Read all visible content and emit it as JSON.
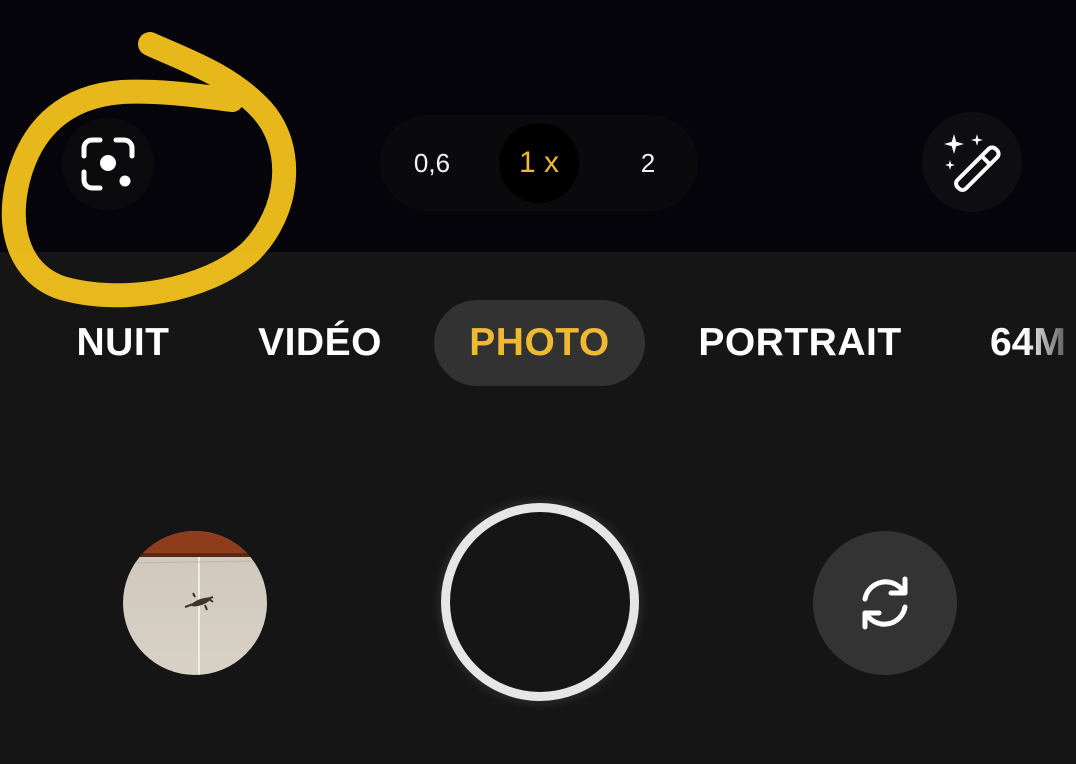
{
  "top_bar": {
    "lens_icon": "google-lens-icon",
    "zoom_options": [
      {
        "label": "0,6",
        "active": false
      },
      {
        "label": "1 x",
        "active": true
      },
      {
        "label": "2",
        "active": false
      }
    ],
    "effects_icon": "magic-wand-icon"
  },
  "modes": [
    {
      "label": "NUIT",
      "active": false
    },
    {
      "label": "VIDÉO",
      "active": false
    },
    {
      "label": "PHOTO",
      "active": true
    },
    {
      "label": "PORTRAIT",
      "active": false
    },
    {
      "label": "64M",
      "active": false
    }
  ],
  "bottom_bar": {
    "gallery_icon": "gallery-thumbnail",
    "shutter_icon": "shutter-icon",
    "switch_icon": "switch-camera-icon"
  },
  "colors": {
    "accent": "#f0b932",
    "annotation": "#f3c21c",
    "active_mode_bg": "#323232"
  }
}
